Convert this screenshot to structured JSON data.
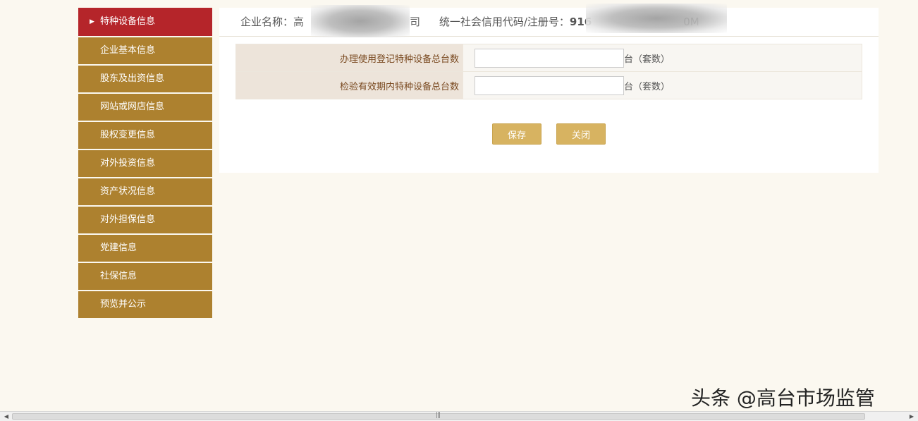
{
  "sidebar": {
    "items": [
      {
        "label": "特种设备信息",
        "active": true
      },
      {
        "label": "企业基本信息"
      },
      {
        "label": "股东及出资信息"
      },
      {
        "label": "网站或网店信息"
      },
      {
        "label": "股权变更信息"
      },
      {
        "label": "对外投资信息"
      },
      {
        "label": "资产状况信息"
      },
      {
        "label": "对外担保信息"
      },
      {
        "label": "党建信息"
      },
      {
        "label": "社保信息"
      },
      {
        "label": "预览并公示"
      }
    ]
  },
  "header": {
    "company_label": "企业名称：",
    "company_value_visible_start": "高",
    "company_value_visible_end": "司",
    "code_label": "统一社会信用代码/注册号：",
    "code_value_visible_start": "916",
    "code_value_visible_end": "0M"
  },
  "form": {
    "rows": [
      {
        "label": "办理使用登记特种设备总台数",
        "value": "",
        "unit": "台（套数）"
      },
      {
        "label": "检验有效期内特种设备总台数",
        "value": "",
        "unit": "台（套数）"
      }
    ]
  },
  "buttons": {
    "save": "保存",
    "close": "关闭"
  },
  "watermark": "头条 @高台市场监管",
  "colors": {
    "sidebar_bg": "#ad812f",
    "sidebar_active": "#b5252a",
    "button_bg": "#d7b361",
    "label_bg": "#ede4da",
    "label_text": "#7a4a21",
    "page_bg": "#fbf8f0"
  }
}
